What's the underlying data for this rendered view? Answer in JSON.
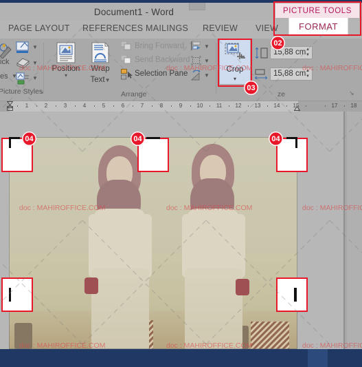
{
  "window": {
    "title": "Document1 - Word",
    "contextual_tab_group": "PICTURE TOOLS",
    "contextual_tab": "FORMAT"
  },
  "ribbon": {
    "tabs": [
      {
        "label": "PAGE LAYOUT"
      },
      {
        "label": "REFERENCES"
      },
      {
        "label": "MAILINGS"
      },
      {
        "label": "REVIEW"
      },
      {
        "label": "VIEW"
      }
    ],
    "groups": [
      {
        "name": "Picture Styles",
        "icons": [
          "picture-border-icon",
          "picture-effects-icon",
          "picture-layout-icon"
        ],
        "partial_labels": [
          "ick",
          "es"
        ],
        "dialog_launcher": "↘"
      },
      {
        "name": "Arrange",
        "buttons": [
          {
            "label": "Position",
            "caret": "▾",
            "icon": "position-icon"
          },
          {
            "label": "Wrap",
            "label2": "Text",
            "caret": "▾",
            "icon": "wrap-text-icon"
          }
        ],
        "items": [
          {
            "label": "Bring Forward",
            "enabled": false,
            "icon": "bring-forward-icon"
          },
          {
            "label": "Send Backward",
            "enabled": false,
            "icon": "send-backward-icon"
          },
          {
            "label": "Selection Pane",
            "enabled": true,
            "icon": "selection-pane-icon"
          }
        ],
        "small_icons": [
          "align-objects-icon",
          "group-objects-icon",
          "rotate-objects-icon"
        ]
      },
      {
        "name": "Size",
        "crop_button": {
          "label": "Crop",
          "caret": "▾",
          "icon": "crop-icon"
        },
        "height_field": {
          "icon": "shape-height-icon",
          "value": "15,88 cm"
        },
        "width_field": {
          "icon": "shape-width-icon",
          "value": "15,88 cm"
        },
        "dialog_launcher": "↘"
      }
    ]
  },
  "callouts": [
    {
      "id": "02",
      "target": "format-tab"
    },
    {
      "id": "03",
      "target": "crop-button"
    },
    {
      "id": "04",
      "target": "crop-handle-top-left"
    },
    {
      "id": "04",
      "target": "crop-handle-top-center"
    },
    {
      "id": "04",
      "target": "crop-handle-top-right"
    }
  ],
  "ruler": {
    "unit_marks": [
      "1",
      "2",
      "3",
      "4",
      "5",
      "6",
      "7",
      "8",
      "9",
      "10",
      "11",
      "12",
      "13",
      "14",
      "15",
      "17",
      "18"
    ]
  },
  "document": {
    "image_selected": true,
    "crop_mode": true,
    "watermark_text": "doc : MAHIROFFICE.COM"
  },
  "status_bar": {
    "view_buttons": [
      {
        "name": "read-mode-icon",
        "active": false
      },
      {
        "name": "print-layout-icon",
        "active": true
      },
      {
        "name": "web-layout-icon",
        "active": false
      }
    ],
    "zoom_control": "zoom-slider"
  },
  "colors": {
    "accent_red": "#e8172a",
    "picture_tools_pink": "#b4175b",
    "status_blue": "#1f3864",
    "ribbon_gray": "#a9a9a9"
  }
}
